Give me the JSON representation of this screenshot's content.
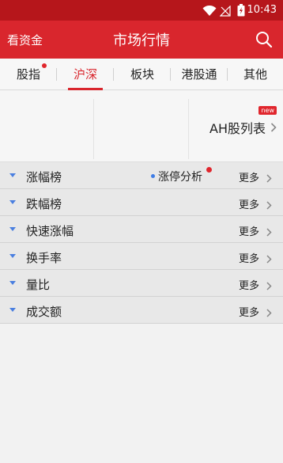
{
  "status_bar": {
    "time": "10:43"
  },
  "app_bar": {
    "left_label": "看资金",
    "title": "市场行情"
  },
  "tabs": [
    {
      "label": "股指",
      "active": false,
      "has_dot": true
    },
    {
      "label": "沪深",
      "active": true,
      "has_dot": false
    },
    {
      "label": "板块",
      "active": false,
      "has_dot": false
    },
    {
      "label": "港股通",
      "active": false,
      "has_dot": false
    },
    {
      "label": "其他",
      "active": false,
      "has_dot": false
    }
  ],
  "ah_section": {
    "link_label": "AH股列表",
    "badge": "new"
  },
  "list": {
    "more_label": "更多",
    "rows": [
      {
        "label": "涨幅榜",
        "extra": "涨停分析"
      },
      {
        "label": "跌幅榜"
      },
      {
        "label": "快速涨幅"
      },
      {
        "label": "换手率"
      },
      {
        "label": "量比"
      },
      {
        "label": "成交额"
      }
    ]
  },
  "colors": {
    "primary_red": "#d9262d",
    "status_red": "#b6161b",
    "accent_blue": "#4a7fe0"
  }
}
